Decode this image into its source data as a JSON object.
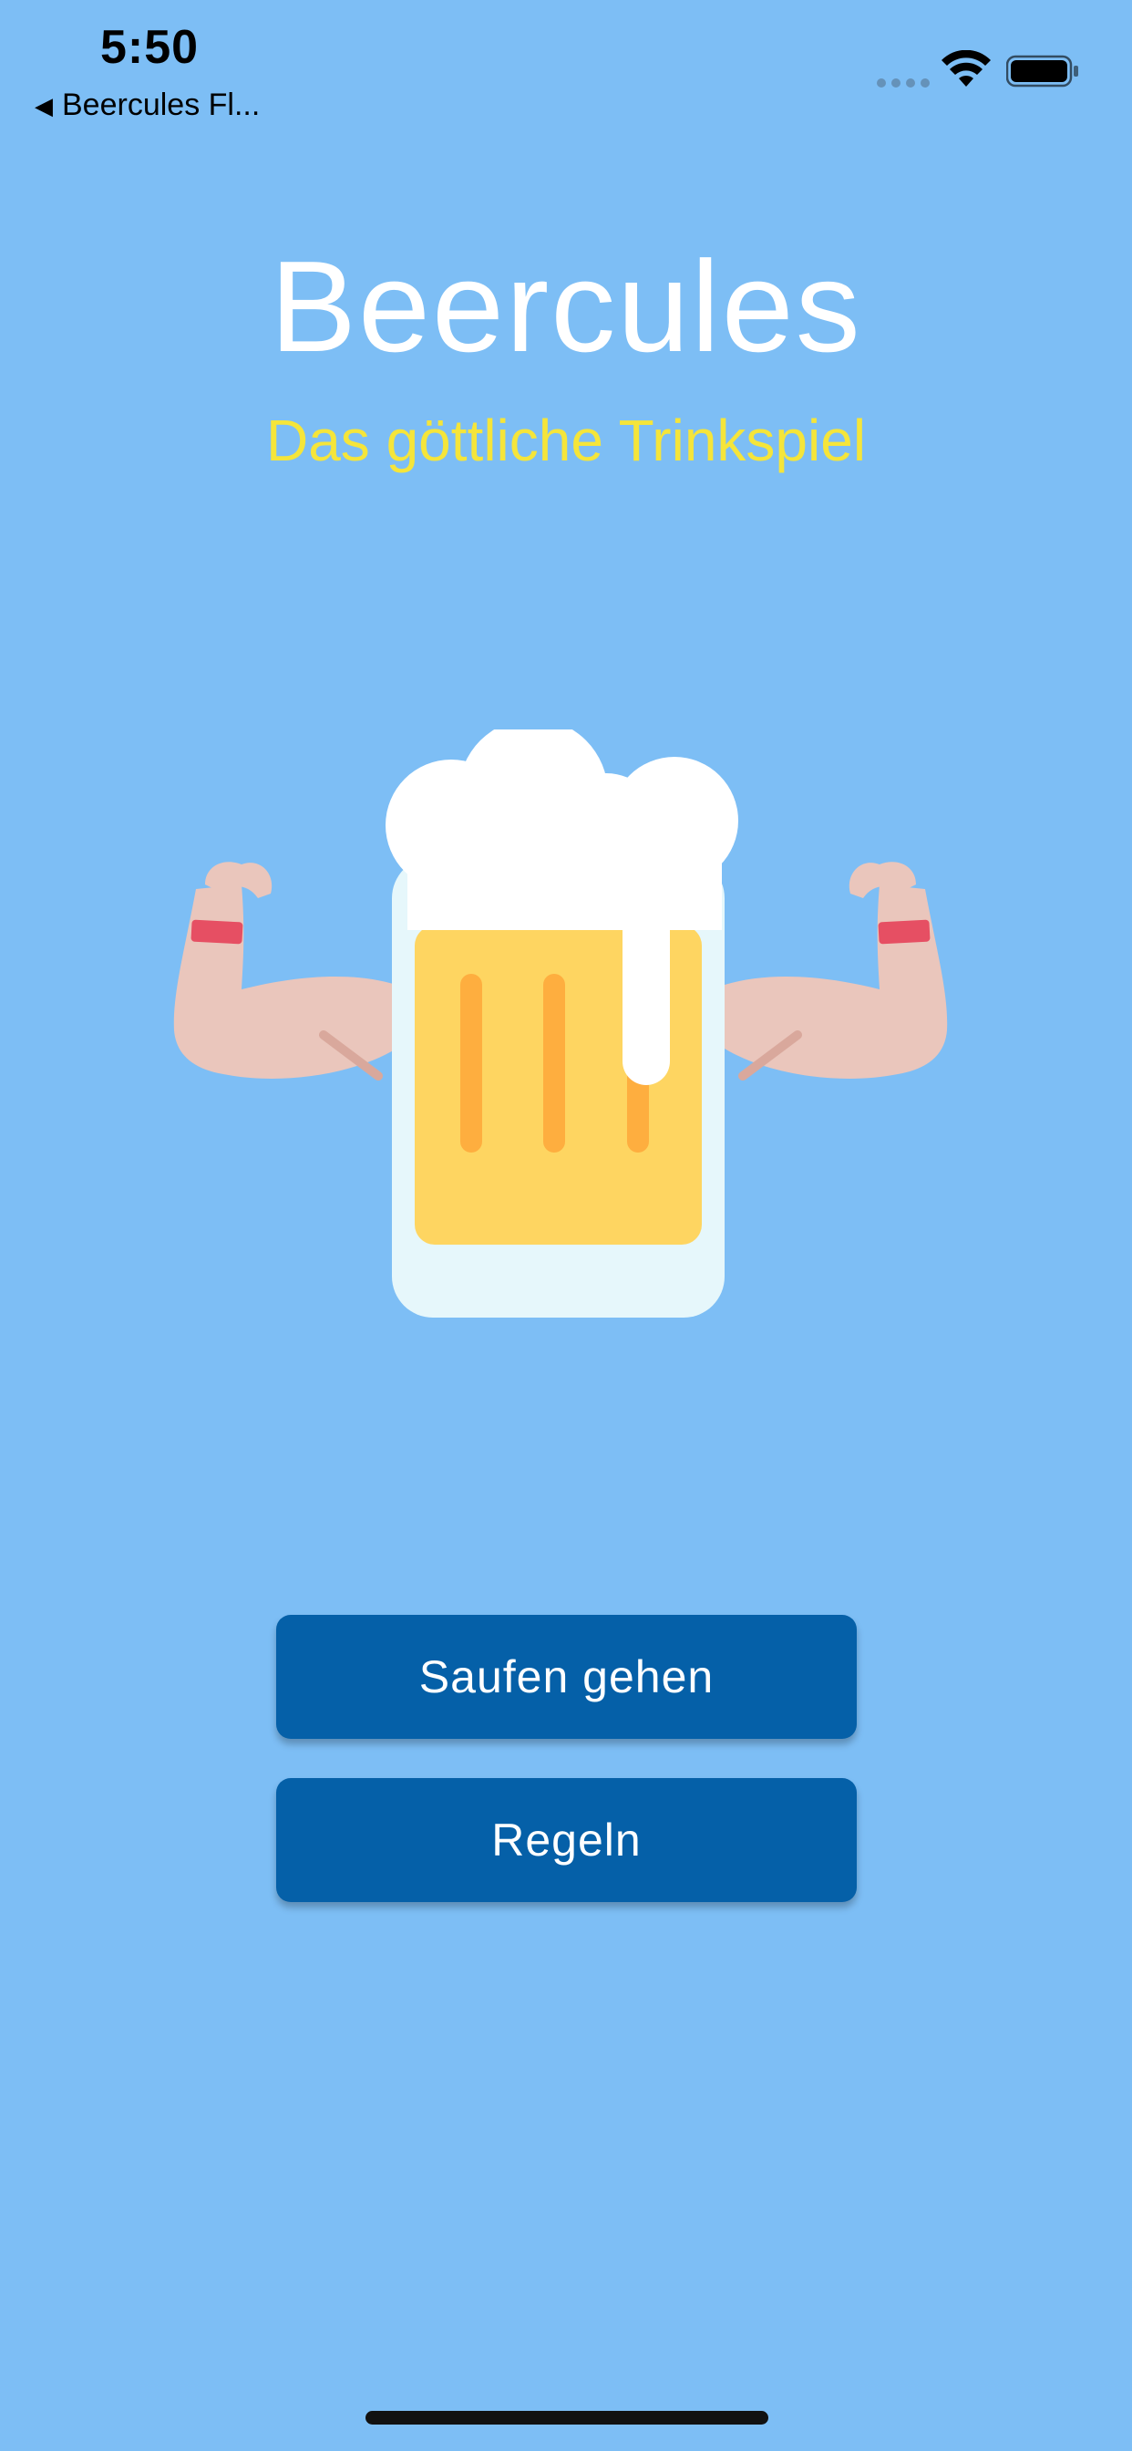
{
  "status_bar": {
    "time": "5:50",
    "back_label": "Beercules Fl...",
    "back_icon": "back-triangle-icon",
    "wifi_icon": "wifi-icon",
    "battery_icon": "battery-icon"
  },
  "header": {
    "title": "Beercules",
    "subtitle": "Das göttliche Trinkspiel"
  },
  "logo": {
    "icon": "muscle-beer-icon"
  },
  "actions": {
    "play_label": "Saufen gehen",
    "rules_label": "Regeln"
  },
  "colors": {
    "background": "#7DBEF5",
    "title": "#FFFFFF",
    "subtitle": "#F5E53A",
    "button": "#0560A8",
    "button_text": "#FFFFFF"
  }
}
